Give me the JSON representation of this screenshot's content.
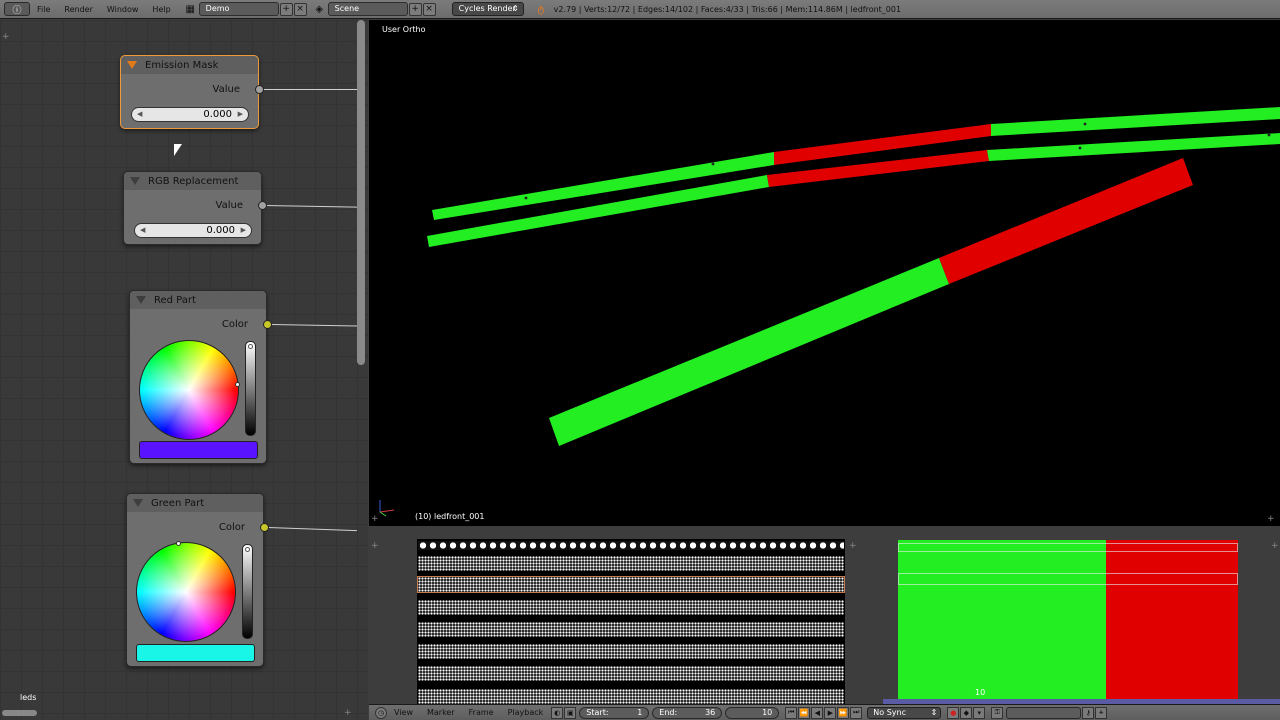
{
  "header": {
    "menus": [
      "File",
      "Render",
      "Window",
      "Help"
    ],
    "screen_layout": "Demo",
    "scene": "Scene",
    "render_engine": "Cycles Render",
    "stats": "v2.79 | Verts:12/72 | Edges:14/102 | Faces:4/33 | Tris:66 | Mem:114.86M | ledfront_001"
  },
  "node_editor": {
    "material_label": "leds",
    "nodes": {
      "emission_mask": {
        "title": "Emission Mask",
        "output": "Value",
        "value": "0.000"
      },
      "rgb_replacement": {
        "title": "RGB Replacement",
        "output": "Value",
        "value": "0.000"
      },
      "red_part": {
        "title": "Red Part",
        "output": "Color",
        "swatch": "#5a13ff"
      },
      "green_part": {
        "title": "Green Part",
        "output": "Color",
        "swatch": "#19f5e6"
      }
    }
  },
  "viewport": {
    "view_name": "User Ortho",
    "object_label": "(10) ledfront_001",
    "colors": {
      "green": "#22ee22",
      "red": "#e00000",
      "background": "#000000"
    }
  },
  "uv_editor": {
    "frame_marker": "10"
  },
  "timeline": {
    "menus": [
      "View",
      "Marker",
      "Frame",
      "Playback"
    ],
    "start_label": "Start:",
    "start_value": "1",
    "end_label": "End:",
    "end_value": "36",
    "current_frame": "10",
    "sync_mode": "No Sync"
  }
}
